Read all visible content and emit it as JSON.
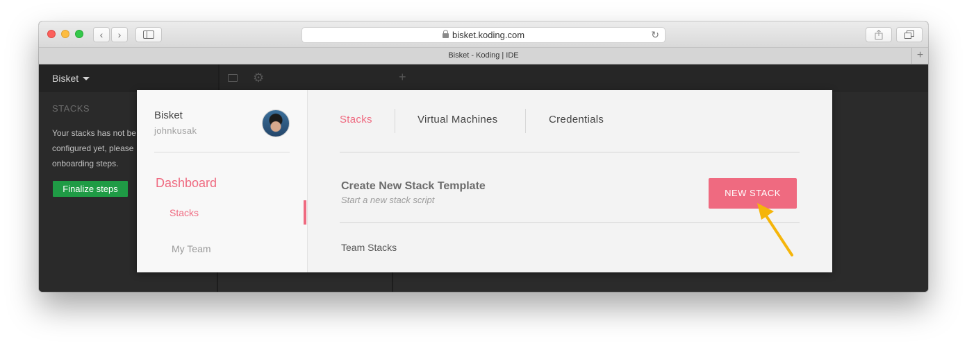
{
  "browser": {
    "url": "bisket.koding.com",
    "tab_title": "Bisket - Koding | IDE",
    "back_glyph": "‹",
    "forward_glyph": "›",
    "new_tab_glyph": "+",
    "reload_glyph": "↻"
  },
  "ide": {
    "team_name": "Bisket",
    "stacks_heading": "STACKS",
    "stacks_message": "Your stacks has not be\nconfigured yet, please\nonboarding steps.",
    "finalize_button": "Finalize steps",
    "add_tab_glyph": "+"
  },
  "modal": {
    "team_name": "Bisket",
    "username": "johnkusak",
    "section_title": "Dashboard",
    "nav": [
      {
        "label": "Stacks",
        "active": true
      },
      {
        "label": "My Team",
        "active": false
      }
    ],
    "tabs": [
      {
        "label": "Stacks",
        "active": true
      },
      {
        "label": "Virtual Machines",
        "active": false
      },
      {
        "label": "Credentials",
        "active": false
      }
    ],
    "create": {
      "title": "Create New Stack Template",
      "subtitle": "Start a new stack script",
      "button": "NEW STACK"
    },
    "team_stacks_heading": "Team Stacks"
  },
  "colors": {
    "accent": "#ef6a80",
    "finalize_green": "#1f9b45",
    "annotation_arrow": "#f5b50a"
  }
}
